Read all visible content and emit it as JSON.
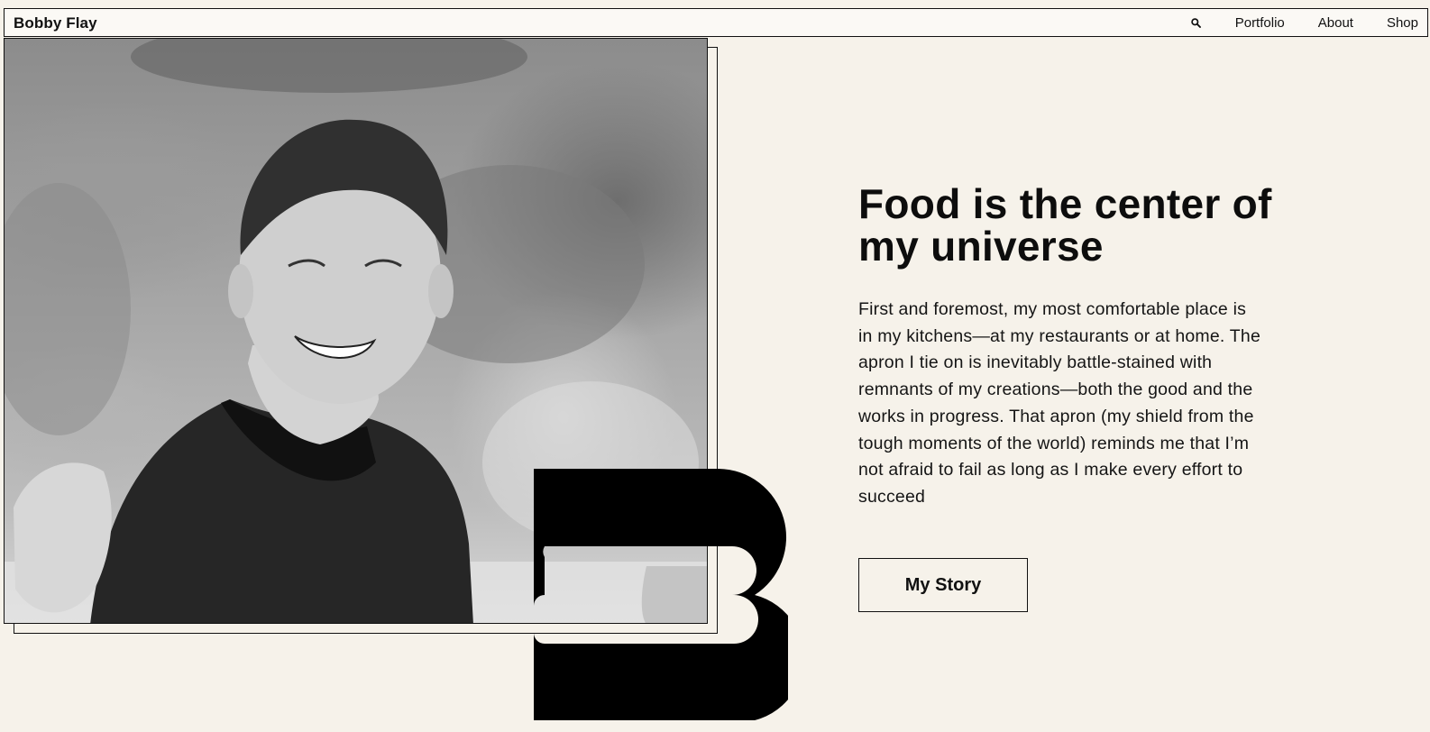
{
  "nav": {
    "brand": "Bobby Flay",
    "search_icon": "search-icon",
    "links": [
      "Portfolio",
      "About",
      "Shop"
    ]
  },
  "hero": {
    "image_alt": "Black and white portrait of a smiling man in a striped sweater",
    "logo_icon": "letter-b-logo",
    "headline": "Food is the center of my universe",
    "body": "First and foremost, my most comfortable place is in my kitchens—at my restaurants or at home. The apron I tie on is inevitably battle-stained with remnants of my creations—both the good and the works in progress. That apron (my shield from the tough moments of the world) reminds me that I’m not afraid to fail as long as I make every effort to succeed",
    "button_label": "My Story"
  },
  "colors": {
    "background": "#f6f2ea",
    "ink": "#111111"
  }
}
